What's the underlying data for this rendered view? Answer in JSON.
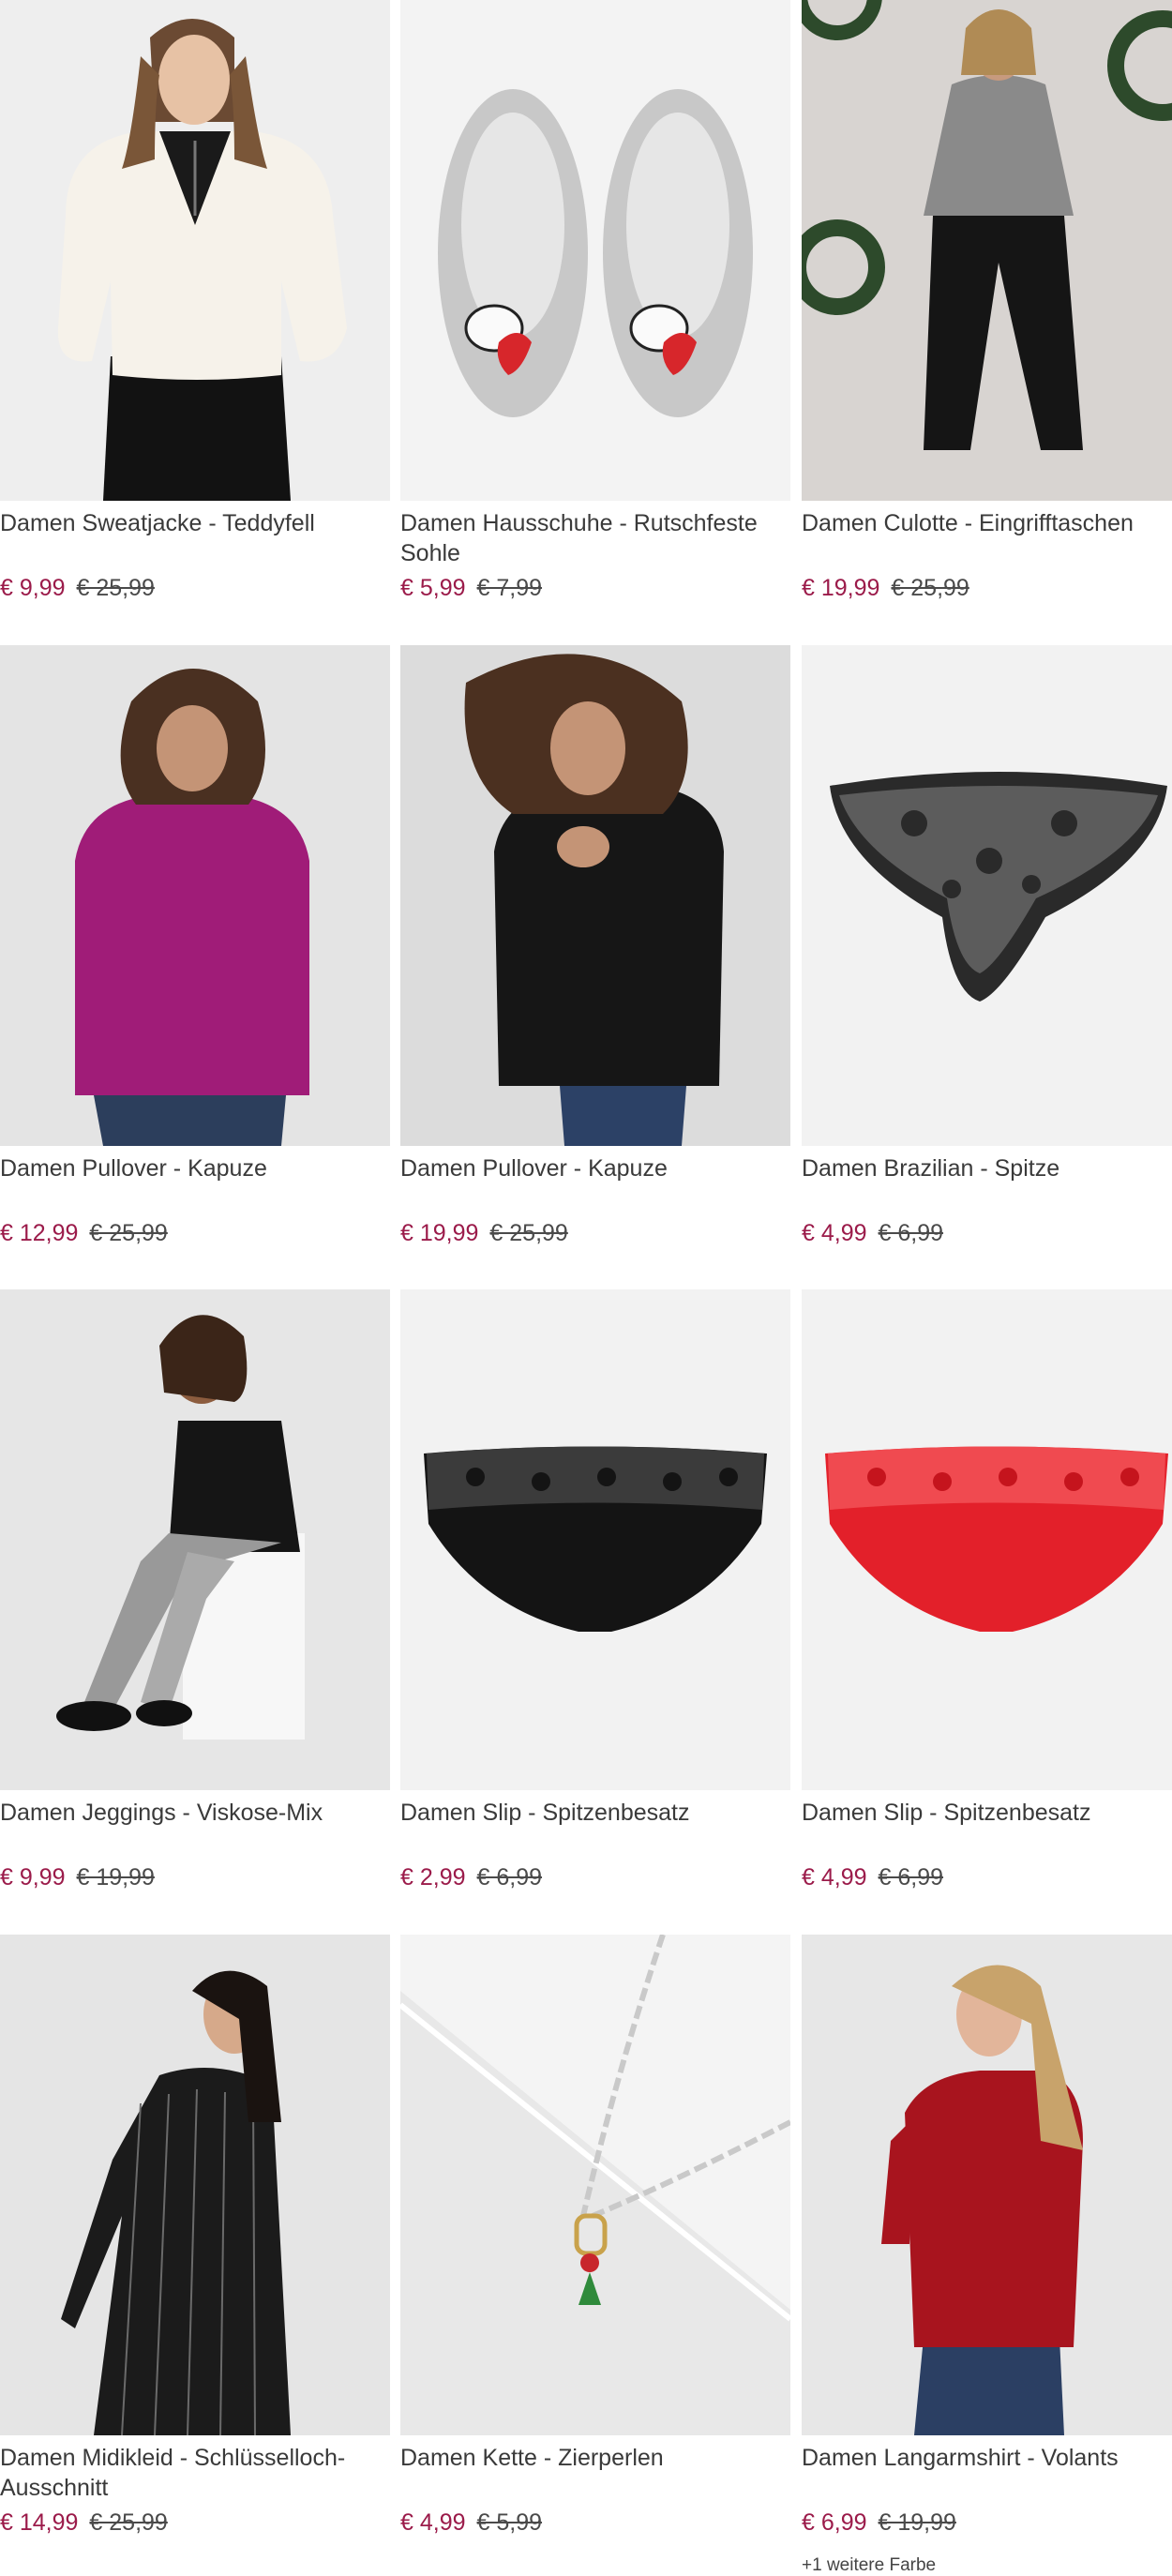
{
  "products": [
    {
      "title": "Damen Sweatjacke - Teddyfell",
      "price": "€ 9,99",
      "old_price": "€ 25,99"
    },
    {
      "title": "Damen Hausschuhe - Rutschfeste Sohle",
      "price": "€ 5,99",
      "old_price": "€ 7,99"
    },
    {
      "title": "Damen Culotte - Eingrifftaschen",
      "price": "€ 19,99",
      "old_price": "€ 25,99"
    },
    {
      "title": "Damen Pullover - Kapuze",
      "price": "€ 12,99",
      "old_price": "€ 25,99"
    },
    {
      "title": "Damen Pullover - Kapuze",
      "price": "€ 19,99",
      "old_price": "€ 25,99"
    },
    {
      "title": "Damen Brazilian - Spitze",
      "price": "€ 4,99",
      "old_price": "€ 6,99"
    },
    {
      "title": "Damen Jeggings - Viskose-Mix",
      "price": "€ 9,99",
      "old_price": "€ 19,99"
    },
    {
      "title": "Damen Slip - Spitzenbesatz",
      "price": "€ 2,99",
      "old_price": "€ 6,99"
    },
    {
      "title": "Damen Slip - Spitzenbesatz",
      "price": "€ 4,99",
      "old_price": "€ 6,99"
    },
    {
      "title": "Damen Midikleid - Schlüsselloch-Ausschnitt",
      "price": "€ 14,99",
      "old_price": "€ 25,99"
    },
    {
      "title": "Damen Kette - Zierperlen",
      "price": "€ 4,99",
      "old_price": "€ 5,99"
    },
    {
      "title": "Damen Langarmshirt - Volants",
      "price": "€ 6,99",
      "old_price": "€ 19,99",
      "more_colors": "+1 weitere Farbe"
    }
  ],
  "colors": {
    "sale_price": "#9b1b4a",
    "old_price": "#4a4a4a",
    "title": "#3a3a3a"
  }
}
